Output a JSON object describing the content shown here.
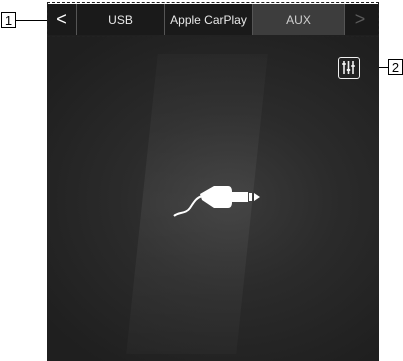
{
  "callouts": {
    "tabbar": "1",
    "equalizer": "2"
  },
  "tabbar": {
    "prev_label": "<",
    "next_label": ">",
    "tabs": [
      {
        "label": "USB",
        "selected": false
      },
      {
        "label": "Apple CarPlay",
        "selected": false
      },
      {
        "label": "AUX",
        "selected": true
      }
    ]
  },
  "icons": {
    "equalizer": "equalizer-icon",
    "aux": "aux-cable-icon"
  },
  "colors": {
    "screen_bg": "#2b2b2b",
    "tabbar_bg": "#1a1a1a",
    "selected_tab_bg": "#3d3d3d",
    "icon": "#ffffff"
  }
}
